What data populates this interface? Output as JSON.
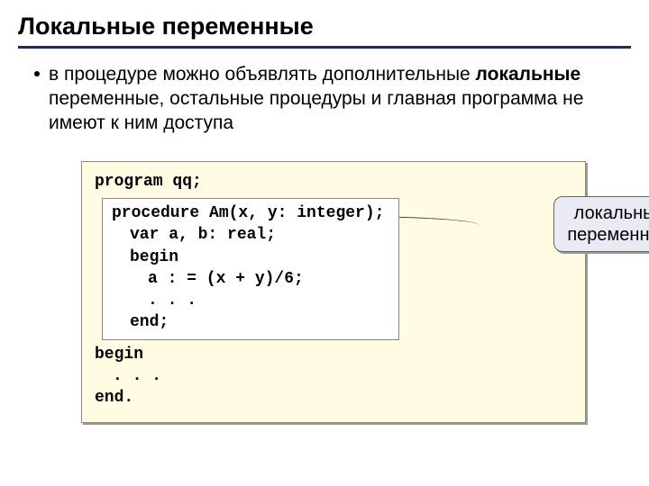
{
  "title": "Локальные переменные",
  "bullet": {
    "pre": "в процедуре можно объявлять дополнительные ",
    "bold": "локальные",
    "post": " переменные, остальные процедуры и главная программа не имеют к ним доступа"
  },
  "code": {
    "l1": "program qq;",
    "proc1": "procedure Am(x, y: integer);",
    "proc2": "var a, b: real;",
    "proc3": "begin",
    "proc4": "a : = (x + y)/6;",
    "proc5": ". . .",
    "proc6": "end;",
    "l2": "begin",
    "l3": ". . .",
    "l4": "end."
  },
  "callout": {
    "line1": "локальные",
    "line2": "переменные"
  }
}
